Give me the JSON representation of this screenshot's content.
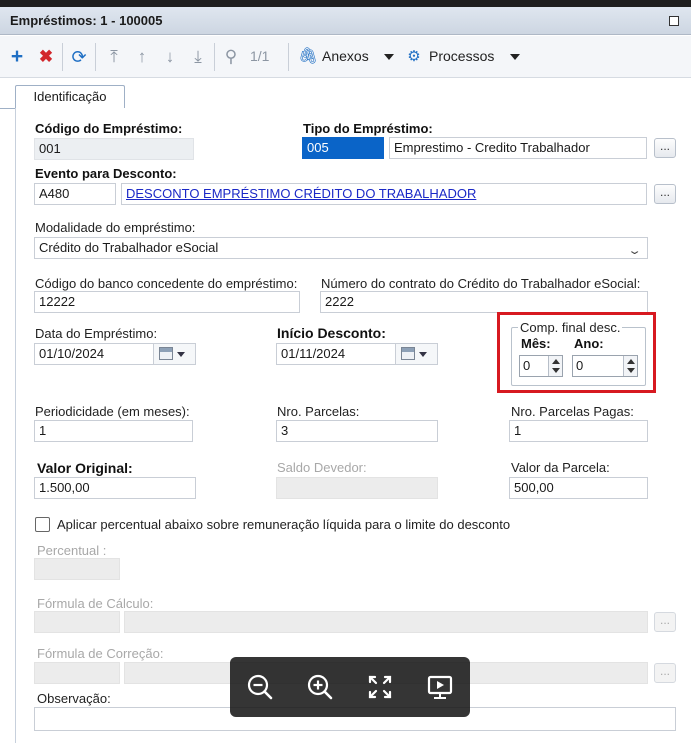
{
  "window": {
    "title": "Empréstimos: 1 - 100005"
  },
  "toolbar": {
    "page_indicator": "1/1",
    "attachments_label": "Anexos",
    "processes_label": "Processos",
    "icons": [
      "plus-icon",
      "delete-icon",
      "refresh-icon",
      "first-icon",
      "previous-icon",
      "next-icon",
      "last-icon",
      "search-icon",
      "paperclip-icon",
      "gear-icon"
    ]
  },
  "tabs": [
    {
      "label": "Identificação",
      "active": true
    }
  ],
  "form": {
    "codigo_emprestimo": {
      "label": "Código do Empréstimo:",
      "value": "001"
    },
    "tipo_emprestimo": {
      "label": "Tipo do Empréstimo:",
      "code": "005",
      "description": "Emprestimo - Credito Trabalhador"
    },
    "evento_desconto": {
      "label": "Evento para Desconto:",
      "code": "A480",
      "description": "DESCONTO EMPRÉSTIMO CRÉDITO DO TRABALHADOR"
    },
    "modalidade": {
      "label": "Modalidade do empréstimo:",
      "value": "Crédito do Trabalhador eSocial"
    },
    "codigo_banco": {
      "label": "Código do banco concedente do empréstimo:",
      "value": "12222"
    },
    "numero_contrato": {
      "label": "Número do contrato do Crédito do Trabalhador eSocial:",
      "value": "2222"
    },
    "data_emprestimo": {
      "label": "Data do Empréstimo:",
      "value": "01/10/2024"
    },
    "inicio_desconto": {
      "label": "Início Desconto:",
      "value": "01/11/2024"
    },
    "comp_final": {
      "label": "Comp. final desc.",
      "mes_label": "Mês:",
      "mes_value": "0",
      "ano_label": "Ano:",
      "ano_value": "0"
    },
    "periodicidade": {
      "label": "Periodicidade (em meses):",
      "value": "1"
    },
    "nro_parcelas": {
      "label": "Nro. Parcelas:",
      "value": "3"
    },
    "nro_parcelas_pagas": {
      "label": "Nro. Parcelas Pagas:",
      "value": "1"
    },
    "valor_original": {
      "label": "Valor Original:",
      "value": "1.500,00"
    },
    "saldo_devedor": {
      "label": "Saldo Devedor:",
      "value": ""
    },
    "valor_parcela": {
      "label": "Valor da Parcela:",
      "value": "500,00"
    },
    "aplicar_percentual": {
      "label": "Aplicar percentual abaixo sobre remuneração líquida para o limite do desconto",
      "checked": false
    },
    "percentual": {
      "label": "Percentual :"
    },
    "formula_calculo": {
      "label": "Fórmula de Cálculo:"
    },
    "formula_correcao": {
      "label": "Fórmula de Correção:"
    },
    "observacao": {
      "label": "Observação:"
    },
    "ellipsis_label": "..."
  },
  "image_viewer": {
    "icons": [
      "zoom-out-icon",
      "zoom-in-icon",
      "fullscreen-icon",
      "slideshow-icon"
    ]
  },
  "colors": {
    "accent": "#0a64c8",
    "highlight_box": "#d71920",
    "link": "#1a28c7"
  }
}
